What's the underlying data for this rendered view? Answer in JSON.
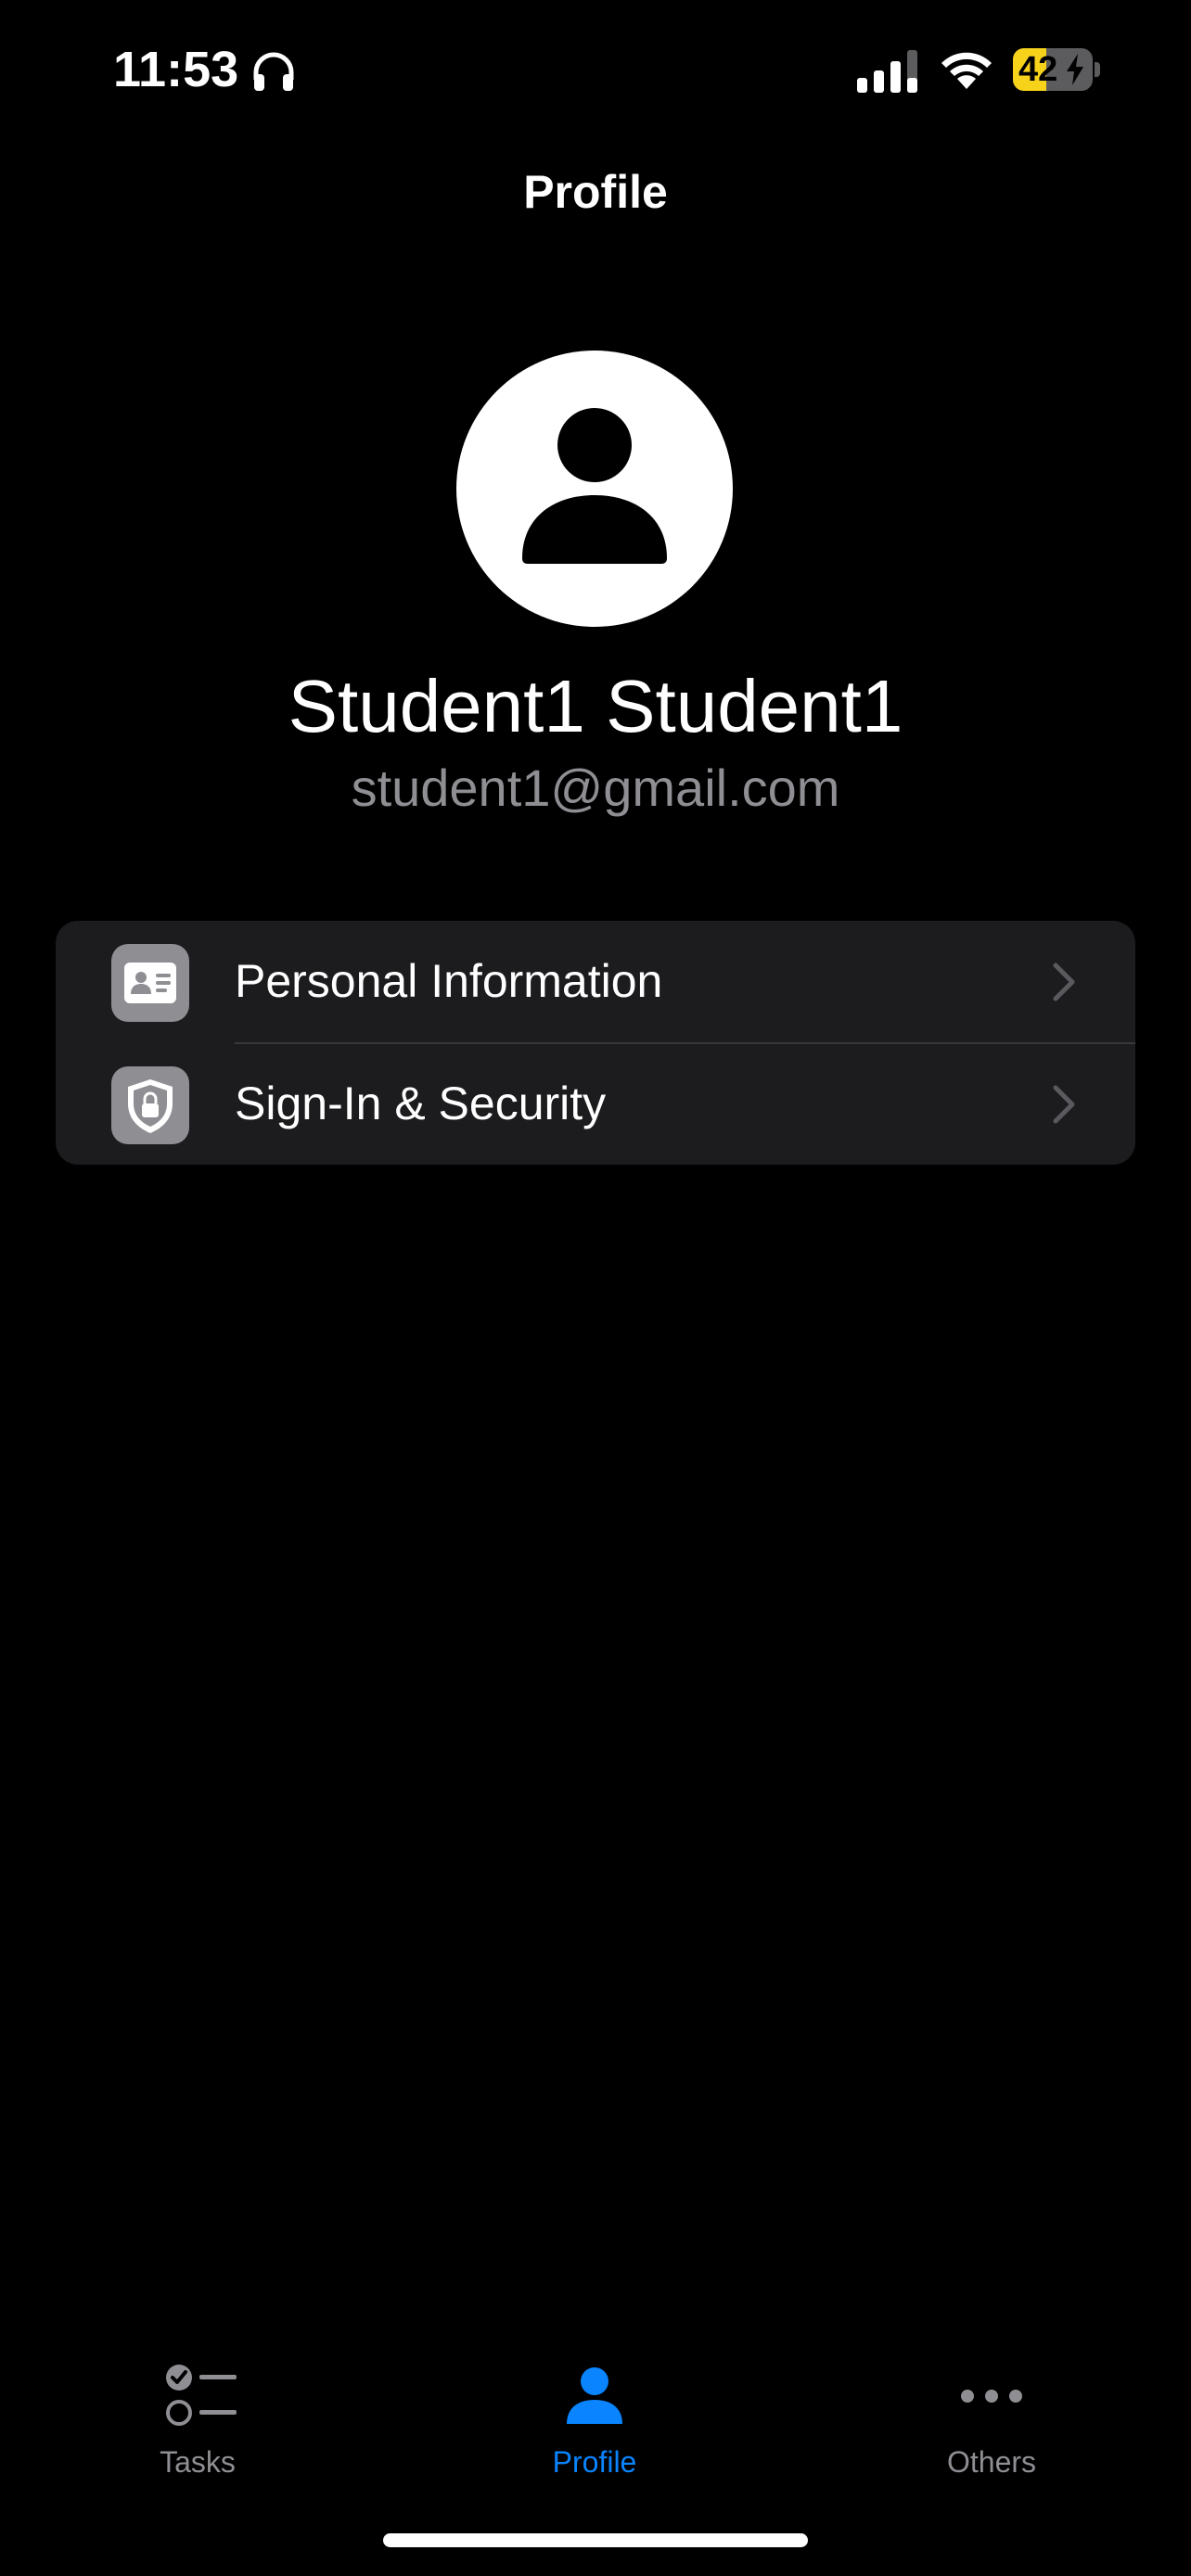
{
  "status_bar": {
    "time": "11:53",
    "battery_level": "42",
    "battery_fraction": 0.42,
    "icons": [
      "headphones-icon",
      "cellular-signal-icon",
      "wifi-icon",
      "battery-charging-icon"
    ]
  },
  "nav": {
    "title": "Profile"
  },
  "profile": {
    "avatar_icon": "person-silhouette-icon",
    "name": "Student1 Student1",
    "email": "student1@gmail.com"
  },
  "settings": {
    "items": [
      {
        "label": "Personal Information",
        "icon": "id-card-icon"
      },
      {
        "label": "Sign-In & Security",
        "icon": "shield-lock-icon"
      }
    ]
  },
  "tab_bar": {
    "tabs": [
      {
        "label": "Tasks",
        "icon": "checklist-icon",
        "active": false
      },
      {
        "label": "Profile",
        "icon": "person-icon",
        "active": true
      },
      {
        "label": "Others",
        "icon": "ellipsis-icon",
        "active": false
      }
    ]
  },
  "colors": {
    "background": "#000000",
    "group_background": "#1c1c1e",
    "secondary_text": "#8e8e93",
    "accent": "#0a84ff",
    "battery_fill": "#f7d21b"
  }
}
